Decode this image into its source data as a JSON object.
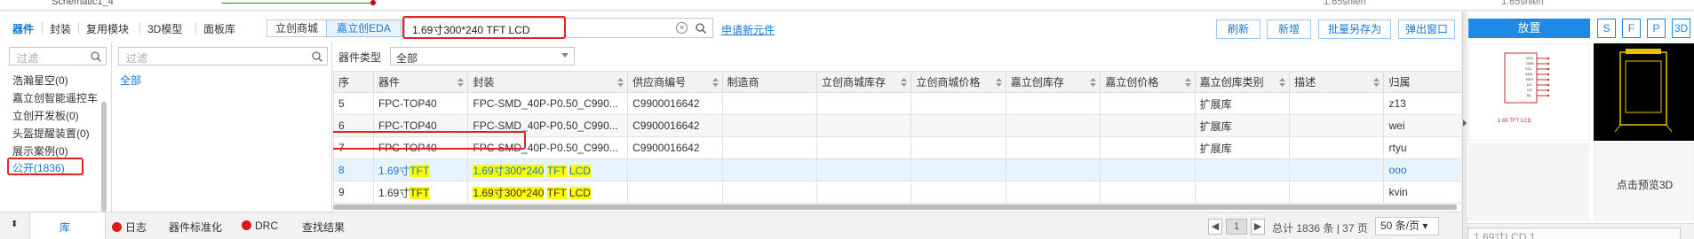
{
  "top": {
    "schematic_label": "Schematic1_4",
    "right_text_1": "1.65shien",
    "right_text_2": "1.65shien"
  },
  "tabs": [
    {
      "label": "器件",
      "active": true
    },
    {
      "label": "封装"
    },
    {
      "label": "复用模块"
    },
    {
      "label": "3D模型"
    },
    {
      "label": "面板库"
    }
  ],
  "source_buttons": [
    "立创商城",
    "嘉立创EDA"
  ],
  "search": {
    "value": "1.69寸300*240 TFT LCD"
  },
  "apply_link": "申请新元件",
  "actions": [
    "刷新",
    "新增",
    "批量另存为",
    "弹出窗口"
  ],
  "left": {
    "filter_placeholder": "过滤",
    "categories": [
      "浩瀚星空(0)",
      "嘉立创智能遥控车",
      "立创开发板(0)",
      "头盔提醒装置(0)",
      "展示案例(0)",
      "公开(1836)"
    ]
  },
  "middle": {
    "filter_placeholder": "过滤",
    "all": "全部"
  },
  "table": {
    "type_label": "器件类型",
    "type_value": "全部",
    "columns": [
      "序",
      "器件",
      "封装",
      "供应商编号",
      "制造商",
      "立创商城库存",
      "立创商城价格",
      "嘉立创库存",
      "嘉立创价格",
      "嘉立创库类别",
      "描述",
      "归属"
    ],
    "rows": [
      {
        "no": "5",
        "device": "FPC-TOP40",
        "footprint": "FPC-SMD_40P-P0.50_C990...",
        "supplier": "C9900016642",
        "category": "扩展库",
        "owner": "z13"
      },
      {
        "no": "6",
        "device": "FPC-TOP40",
        "footprint": "FPC-SMD_40P-P0.50_C990...",
        "supplier": "C9900016642",
        "category": "扩展库",
        "owner": "wei"
      },
      {
        "no": "7",
        "device": "FPC-TOP40",
        "footprint": "FPC-SMD_40P-P0.50_C990...",
        "supplier": "C9900016642",
        "category": "扩展库",
        "owner": "rtyu"
      },
      {
        "no": "8",
        "device_a": "1.69寸",
        "device_b": "TFT",
        "fp_a": "1.69寸300*240",
        "fp_b": "TFT",
        "fp_c": "LCD",
        "owner": "ooo"
      },
      {
        "no": "9",
        "device_a": "1.69寸",
        "device_b": "TFT",
        "fp_a": "1.69寸300*240",
        "fp_b": "TFT",
        "fp_c": "LCD",
        "owner": "kvin"
      }
    ]
  },
  "bottom": {
    "tabs": [
      "库",
      "日志",
      "器件标准化",
      "DRC",
      "查找结果"
    ],
    "page": "1",
    "summary": "总计 1836 条 | 37 页",
    "page_size": "50 条/页"
  },
  "right": {
    "place_label": "放置",
    "mode_buttons": [
      "S",
      "F",
      "P",
      "3D"
    ],
    "symbol_label": "1.69 TFT LCD",
    "preview_3d": "点击预览3D",
    "selected": "1.69寸LCD.1"
  },
  "colors": {
    "accent": "#1677d8",
    "highlight": "#ffff00",
    "annotation": "#e02424"
  }
}
